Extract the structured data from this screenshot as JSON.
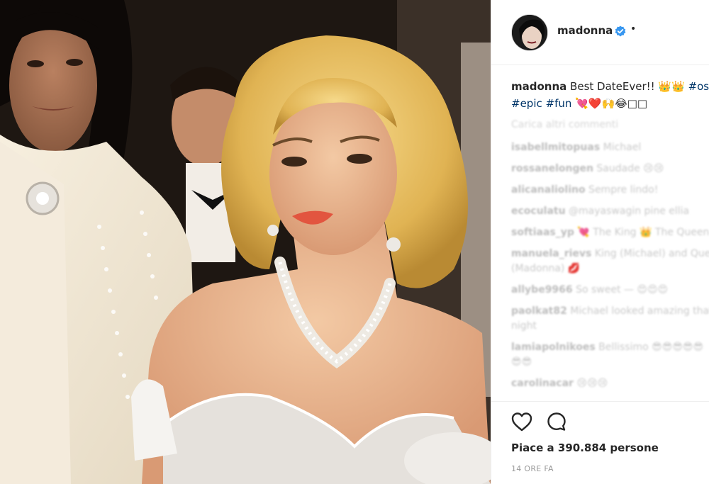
{
  "post": {
    "username": "madonna",
    "more_dot": "•",
    "caption_user": "madonna",
    "caption_text": " Best DateEver!! 👑👑 ",
    "caption_tag_1": "#oscars",
    "caption_tag_2": "#epic",
    "caption_tag_3": "#fun",
    "caption_emoji": " 💘❤️🙌😂□□",
    "more_comments": "Carica altri commenti",
    "comments": [
      {
        "user": "isabellmitopuas",
        "text": " Michael"
      },
      {
        "user": "rossanelongen",
        "text": " Saudade 😢😢"
      },
      {
        "user": "alicanaliolino",
        "text": " Sempre lindo!"
      },
      {
        "user": "ecoculatu",
        "text": " @mayaswagin pine ellia"
      },
      {
        "user": "softiaas_yp",
        "text": " 💘 The King 👑 The Queen"
      },
      {
        "user": "manuela_rievs",
        "text": " King (Michael) and Queen"
      },
      {
        "user": "",
        "text": "(Madonna) 💋"
      },
      {
        "user": "allybe9966",
        "text": " So sweet — 😍😍😍"
      },
      {
        "user": "paolkat82",
        "text": " Michael looked amazing that"
      },
      {
        "user": "",
        "text": "night"
      },
      {
        "user": "lamiapolnikoes",
        "text": " Bellissimo 😎😎😎😎😎"
      },
      {
        "user": "",
        "text": "😎😎"
      },
      {
        "user": "carolinacar",
        "text": " 😢😢😢"
      }
    ],
    "likes_text": "Piace a 390.884 persone",
    "timestamp": "14 ORE FA"
  },
  "colors": {
    "verified_blue": "#3897f0",
    "tag_link": "#003569",
    "text_primary": "#262626",
    "text_muted": "#999999"
  },
  "icons": {
    "verified": "verified-badge-icon",
    "like": "heart-icon",
    "comment": "comment-bubble-icon"
  }
}
